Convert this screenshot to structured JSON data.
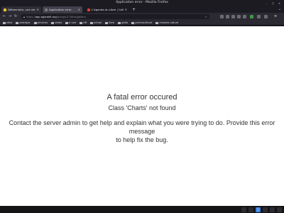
{
  "window": {
    "title": "Application error - Mozilla Firefox"
  },
  "tabs": [
    {
      "label": "Débonnaire, une vie parfois ...",
      "favicon_color": "#f2c230",
      "active": false
    },
    {
      "label": "Application error",
      "favicon_color": "#7a7a80",
      "active": true
    },
    {
      "label": "L'Agenda du Libre | Coll.G ...",
      "favicon_color": "#e0442e",
      "active": false
    }
  ],
  "nav": {
    "url_dim": "https://",
    "url_domain": "app.agorakit.org",
    "url_path": "/groups/17/files/gallery"
  },
  "bookmarks": [
    "sites",
    "pratique",
    "services",
    "video",
    "à voir",
    "tiff",
    "actual",
    "libre",
    "gaita",
    "permaculture",
    "musees nature"
  ],
  "page": {
    "title": "A fatal error occured",
    "subtitle": "Class 'Charts' not found",
    "message_line1": "Contact the server admin to get help and explain what you were trying to do. Provide this error message",
    "message_line2": "to help fix the bug."
  },
  "taskbar": {
    "page_number": "1"
  },
  "colors": {
    "accent": "#3b84e6",
    "chrome": "#2b2a33",
    "text": "#333333"
  }
}
